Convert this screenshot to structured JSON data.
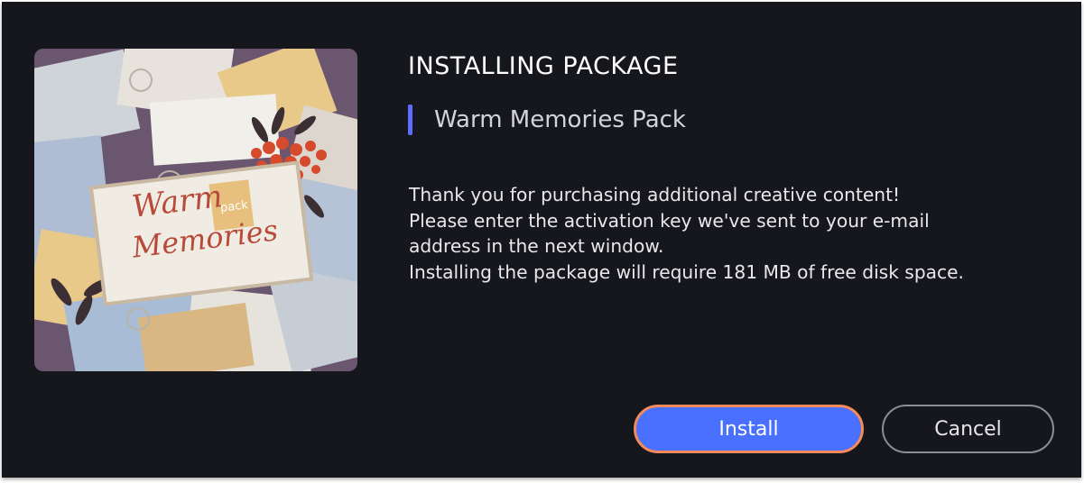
{
  "dialog": {
    "title": "INSTALLING PACKAGE",
    "package_name": "Warm Memories Pack",
    "description_lines": [
      "Thank you for purchasing additional creative content!",
      "Please enter the activation key we've sent to your e-mail address in the next window.",
      "Installing the package will require 181 MB of free disk space."
    ],
    "thumbnail": {
      "title_line1": "Warm",
      "title_line2": "Memories",
      "badge": "pack"
    },
    "buttons": {
      "install_label": "Install",
      "cancel_label": "Cancel"
    }
  },
  "colors": {
    "background": "#16171c",
    "accent_bar": "#5f6dff",
    "install_button": "#4a70ff",
    "install_focus_ring": "#f58a5a",
    "cancel_border": "#8a8c96"
  }
}
